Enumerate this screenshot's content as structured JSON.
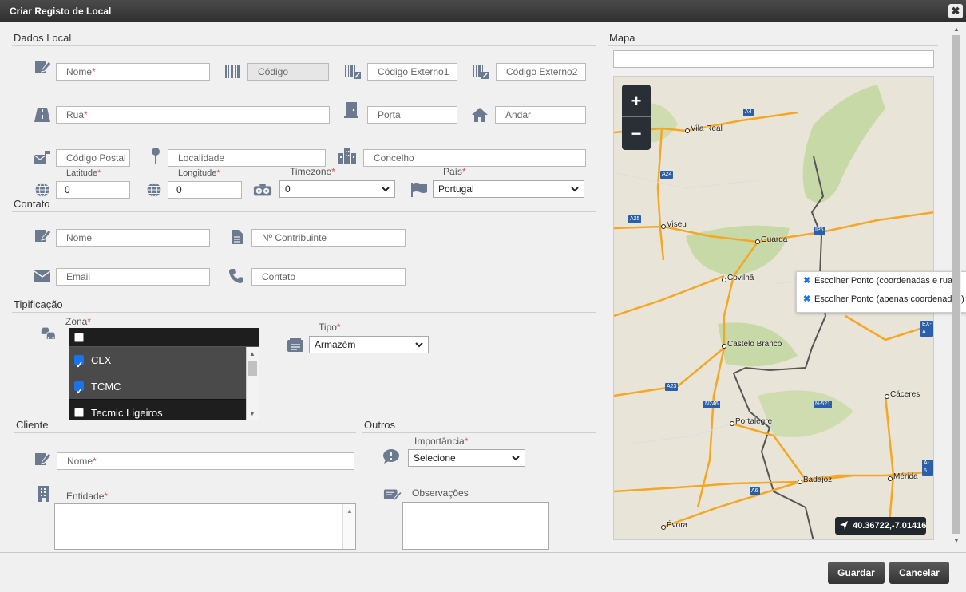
{
  "window": {
    "title": "Criar Registo de Local"
  },
  "dados_local": {
    "title": "Dados Local",
    "nome": "Nome",
    "codigo": "Código",
    "codigo_externo1": "Código Externo1",
    "codigo_externo2": "Código Externo2",
    "rua": "Rua",
    "porta": "Porta",
    "andar": "Andar",
    "codigo_postal": "Código Postal",
    "localidade": "Localidade",
    "concelho": "Concelho",
    "latitude_label": "Latitude",
    "latitude_value": "0",
    "longitude_label": "Longitude",
    "longitude_value": "0",
    "timezone_label": "Timezone",
    "timezone_value": "0",
    "pais_label": "País",
    "pais_value": "Portugal"
  },
  "contato": {
    "title": "Contato",
    "nome": "Nome",
    "contribuinte": "Nº Contribuinte",
    "email": "Email",
    "contacto": "Contato"
  },
  "tipificacao": {
    "title": "Tipificação",
    "zona_label": "Zona",
    "zonas": [
      {
        "label": "CLX",
        "checked": true
      },
      {
        "label": "TCMC",
        "checked": true
      },
      {
        "label": "Tecmic Ligeiros",
        "checked": false
      }
    ],
    "tipo_label": "Tipo",
    "tipo_value": "Armazém"
  },
  "cliente": {
    "title": "Cliente",
    "nome": "Nome",
    "entidade_label": "Entidade"
  },
  "outros": {
    "title": "Outros",
    "importancia_label": "Importância",
    "importancia_value": "Selecione",
    "observacoes_label": "Observações"
  },
  "mapa": {
    "title": "Mapa",
    "zoom_in": "+",
    "zoom_out": "−",
    "context_menu": [
      "Escolher Ponto (coordenadas e rua)",
      "Escolher Ponto (apenas coordenadas)"
    ],
    "coordinates": "40.36722,-7.01416",
    "places": [
      {
        "name": "Vila Real"
      },
      {
        "name": "Viseu"
      },
      {
        "name": "Guarda"
      },
      {
        "name": "Covilhã"
      },
      {
        "name": "Castelo Branco"
      },
      {
        "name": "Cáceres"
      },
      {
        "name": "Portalegre"
      },
      {
        "name": "Badajoz"
      },
      {
        "name": "Mérida"
      },
      {
        "name": "Évora"
      }
    ],
    "roads": [
      "A4",
      "A24",
      "A25",
      "IP5",
      "A23",
      "N246",
      "N-521",
      "A6",
      "EX-A",
      "A-5"
    ],
    "colors": {
      "road": "#f5a623",
      "border": "#555555",
      "park": "#c8d9a8"
    }
  },
  "footer": {
    "save": "Guardar",
    "cancel": "Cancelar"
  },
  "required_mark": "*"
}
